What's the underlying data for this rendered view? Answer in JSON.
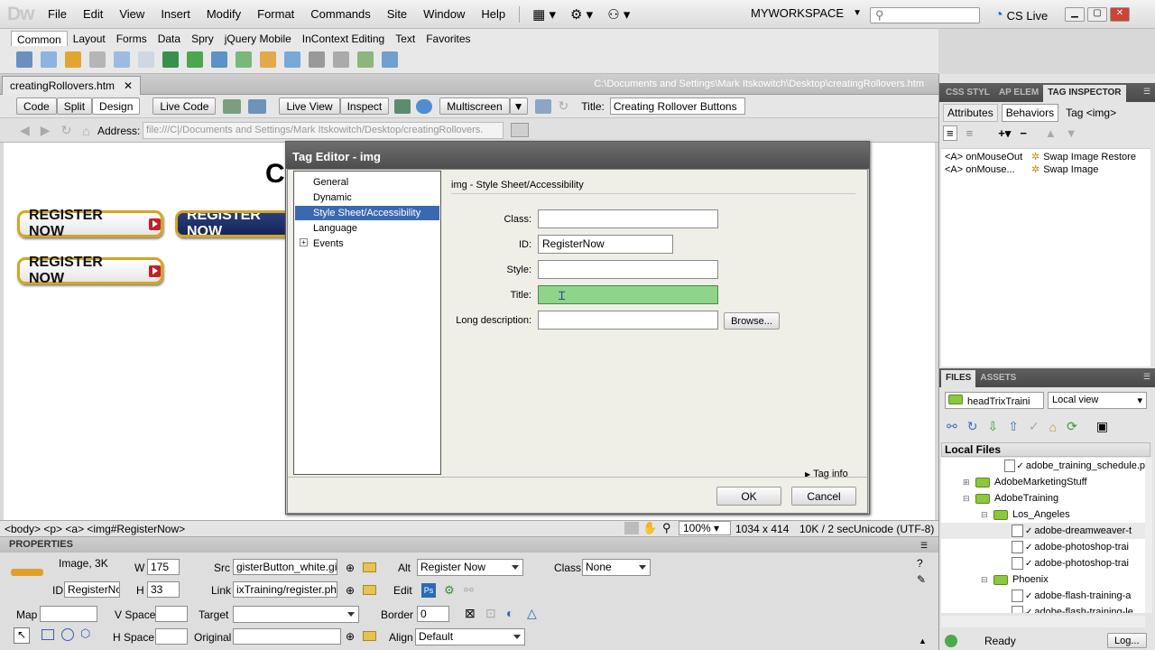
{
  "app": {
    "logo": "Dw"
  },
  "menu": [
    "File",
    "Edit",
    "View",
    "Insert",
    "Modify",
    "Format",
    "Commands",
    "Site",
    "Window",
    "Help"
  ],
  "workspace": "MYWORKSPACE",
  "cslive": "CS Live",
  "insert_tabs": [
    "Common",
    "Layout",
    "Forms",
    "Data",
    "Spry",
    "jQuery Mobile",
    "InContext Editing",
    "Text",
    "Favorites"
  ],
  "doc": {
    "tab": "creatingRollovers.htm",
    "path": "C:\\Documents and Settings\\Mark Itskowitch\\Desktop\\creatingRollovers.htm"
  },
  "view_buttons": {
    "code": "Code",
    "split": "Split",
    "design": "Design",
    "live_code": "Live Code",
    "live_view": "Live View",
    "inspect": "Inspect",
    "multiscreen": "Multiscreen"
  },
  "title_label": "Title:",
  "title_value": "Creating Rollover Buttons",
  "address_label": "Address:",
  "address_value": "file:///C|/Documents and Settings/Mark Itskowitch/Desktop/creatingRollovers.",
  "canvas": {
    "heading_char": "C",
    "buttons": [
      "REGISTER NOW",
      "REGISTER NOW",
      "REGISTER NOW"
    ]
  },
  "status": {
    "tags": "<body> <p> <a> <img#RegisterNow>",
    "zoom": "100%",
    "size": "1034 x 414",
    "speed": "10K / 2 sec",
    "encoding": "Unicode (UTF-8)"
  },
  "props": {
    "header": "PROPERTIES",
    "image_label": "Image, 3K",
    "id_label": "ID",
    "id_value": "RegisterNo",
    "w_label": "W",
    "w_value": "175",
    "h_label": "H",
    "h_value": "33",
    "src_label": "Src",
    "src_value": "gisterButton_white.gif",
    "link_label": "Link",
    "link_value": "ixTraining/register.php",
    "alt_label": "Alt",
    "alt_value": "Register Now",
    "edit_label": "Edit",
    "class_label": "Class",
    "class_value": "None",
    "map_label": "Map",
    "vspace_label": "V Space",
    "hspace_label": "H Space",
    "target_label": "Target",
    "original_label": "Original",
    "border_label": "Border",
    "border_value": "0",
    "align_label": "Align",
    "align_value": "Default"
  },
  "rpanel": {
    "tabs": [
      "CSS STYL",
      "AP ELEM",
      "TAG INSPECTOR"
    ],
    "subtabs": [
      "Attributes",
      "Behaviors",
      "Tag <img>"
    ],
    "behaviors": [
      {
        "event": "<A> onMouseOut",
        "action": "Swap Image Restore"
      },
      {
        "event": "<A> onMouse...",
        "action": "Swap Image"
      }
    ],
    "files_tabs": [
      "FILES",
      "ASSETS"
    ],
    "site": "headTrixTraini",
    "view": "Local view",
    "local_files": "Local Files",
    "files": [
      {
        "name": "adobe_training_schedule.p",
        "type": "file",
        "indent": 4
      },
      {
        "name": "AdobeMarketingStuff",
        "type": "folder",
        "indent": 2,
        "exp": "+"
      },
      {
        "name": "AdobeTraining",
        "type": "folder",
        "indent": 2,
        "exp": "-"
      },
      {
        "name": "Los_Angeles",
        "type": "folder",
        "indent": 3,
        "exp": "-"
      },
      {
        "name": "adobe-dreamweaver-t",
        "type": "file",
        "indent": 4
      },
      {
        "name": "adobe-photoshop-trai",
        "type": "file",
        "indent": 4
      },
      {
        "name": "adobe-photoshop-trai",
        "type": "file",
        "indent": 4
      },
      {
        "name": "Phoenix",
        "type": "folder",
        "indent": 3,
        "exp": "-"
      },
      {
        "name": "adobe-flash-training-a",
        "type": "file",
        "indent": 4
      },
      {
        "name": "adobe-flash-training-le",
        "type": "file",
        "indent": 4
      }
    ],
    "ready": "Ready",
    "log": "Log..."
  },
  "dialog": {
    "title": "Tag Editor - img",
    "categories": [
      "General",
      "Dynamic",
      "Style Sheet/Accessibility",
      "Language",
      "Events"
    ],
    "section": "img - Style Sheet/Accessibility",
    "class_label": "Class:",
    "id_label": "ID:",
    "id_value": "RegisterNow",
    "style_label": "Style:",
    "title_label": "Title:",
    "longdesc_label": "Long description:",
    "browse": "Browse...",
    "taginfo": "Tag info",
    "ok": "OK",
    "cancel": "Cancel"
  }
}
